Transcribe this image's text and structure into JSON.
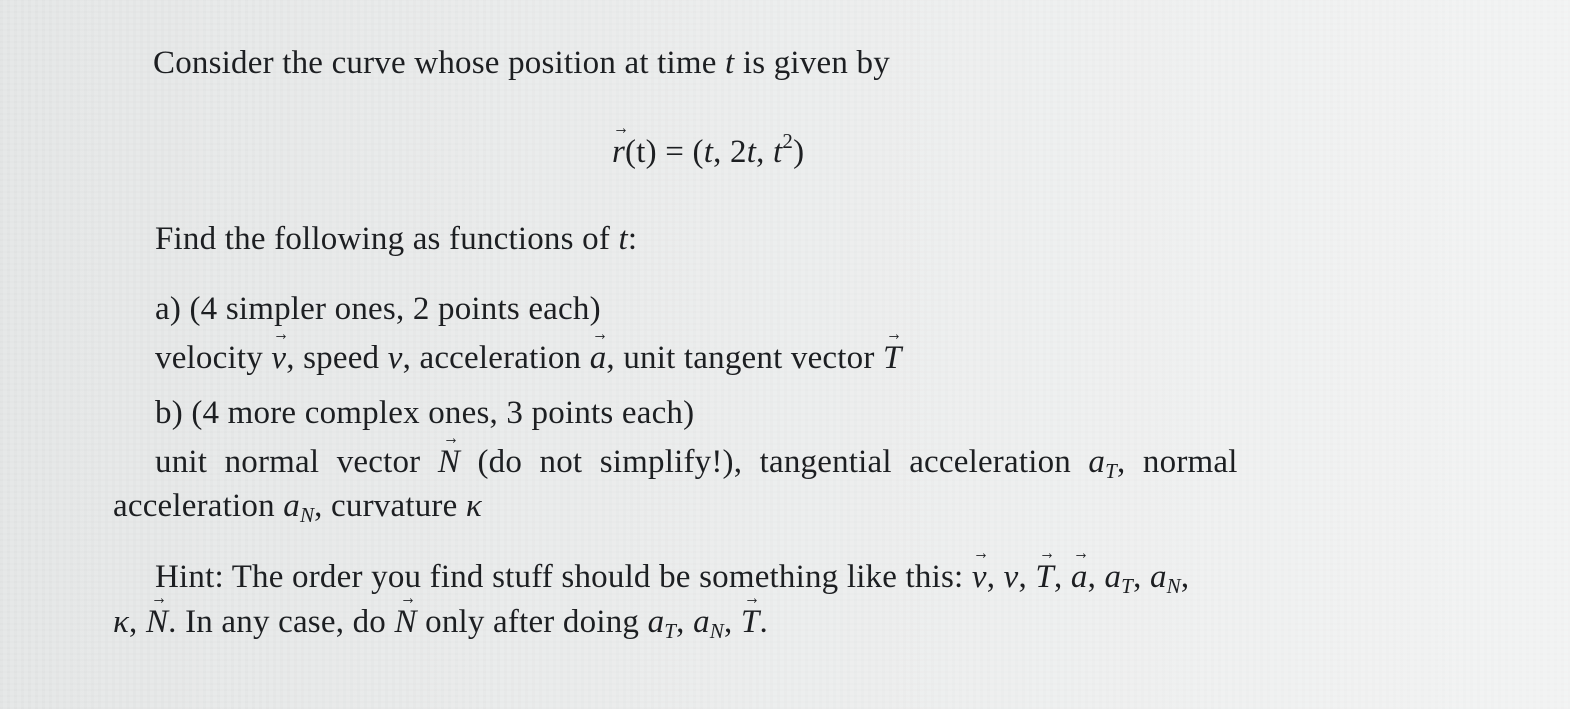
{
  "problem": {
    "intro": {
      "text_before": "Consider the curve whose position at time ",
      "var": "t",
      "text_after": " is given by"
    },
    "equation": {
      "lhs_vec": "r",
      "lhs_arg": "(t)",
      "equals": " = ",
      "rhs_open": "(",
      "rhs_t1": "t",
      "rhs_sep1": ", 2",
      "rhs_t2": "t",
      "rhs_sep2": ", ",
      "rhs_t3": "t",
      "rhs_exp": "2",
      "rhs_close": ")"
    },
    "instruction": {
      "text_before": "Find the following as functions of ",
      "var": "t",
      "text_after": ":"
    },
    "part_a": {
      "header": "a) (4 simpler ones, 2 points each)",
      "items": {
        "velocity_label": "velocity ",
        "velocity_sym": "v",
        "speed_label": ", speed ",
        "speed_sym": "v",
        "accel_label": ", acceleration ",
        "accel_sym": "a",
        "tangent_label": ", unit tangent vector ",
        "tangent_sym": "T"
      }
    },
    "part_b": {
      "header": "b) (4 more complex ones, 3 points each)",
      "items": {
        "normal_label": "unit normal vector ",
        "normal_sym": "N",
        "normal_note": " (do not simplify!), tangential acceleration ",
        "tangential_sym": "a",
        "tangential_sub": "T",
        "normal_accel_label": ", normal",
        "normal_accel_label2": "acceleration ",
        "normal_accel_sym": "a",
        "normal_accel_sub": "N",
        "curvature_label": ", curvature ",
        "curvature_sym": "κ"
      }
    },
    "hint": {
      "text1": "Hint: The order you find stuff should be something like this: ",
      "s1": "v",
      "sep": ", ",
      "s2": "v",
      "s3": "T",
      "s4": "a",
      "s5": "a",
      "s5_sub": "T",
      "s6": "a",
      "s6_sub": "N",
      "line2_kappa": "κ",
      "line2_N": "N",
      "text2": ". In any case, do ",
      "N2": "N",
      "text3": " only after doing ",
      "a1": "a",
      "a1_sub": "T",
      "a2": "a",
      "a2_sub": "N",
      "T": "T",
      "end": "."
    }
  }
}
